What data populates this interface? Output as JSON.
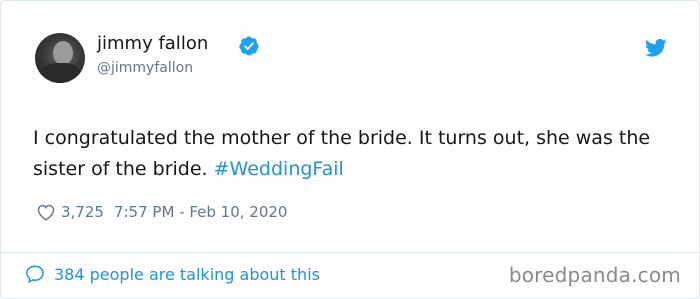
{
  "author": {
    "name": "jimmy fallon",
    "handle": "@jimmyfallon",
    "verified": true,
    "avatar_icon": "profile-photo"
  },
  "tweet": {
    "text_before_hashtag": "I congratulated the mother of the bride. It turns out, she was the sister of the bride.",
    "hashtag": "#WeddingFail"
  },
  "meta": {
    "likes": "3,725",
    "timestamp": "7:57 PM - Feb 10, 2020"
  },
  "footer": {
    "talking_text": "384 people are talking about this",
    "watermark": "boredpanda.com"
  },
  "colors": {
    "accent": "#1b95e0",
    "text": "#14171a",
    "muted": "#657786",
    "border": "#e1e8ed"
  },
  "icons": [
    "verified-badge-icon",
    "twitter-bird-icon",
    "heart-icon",
    "speech-bubble-icon"
  ]
}
